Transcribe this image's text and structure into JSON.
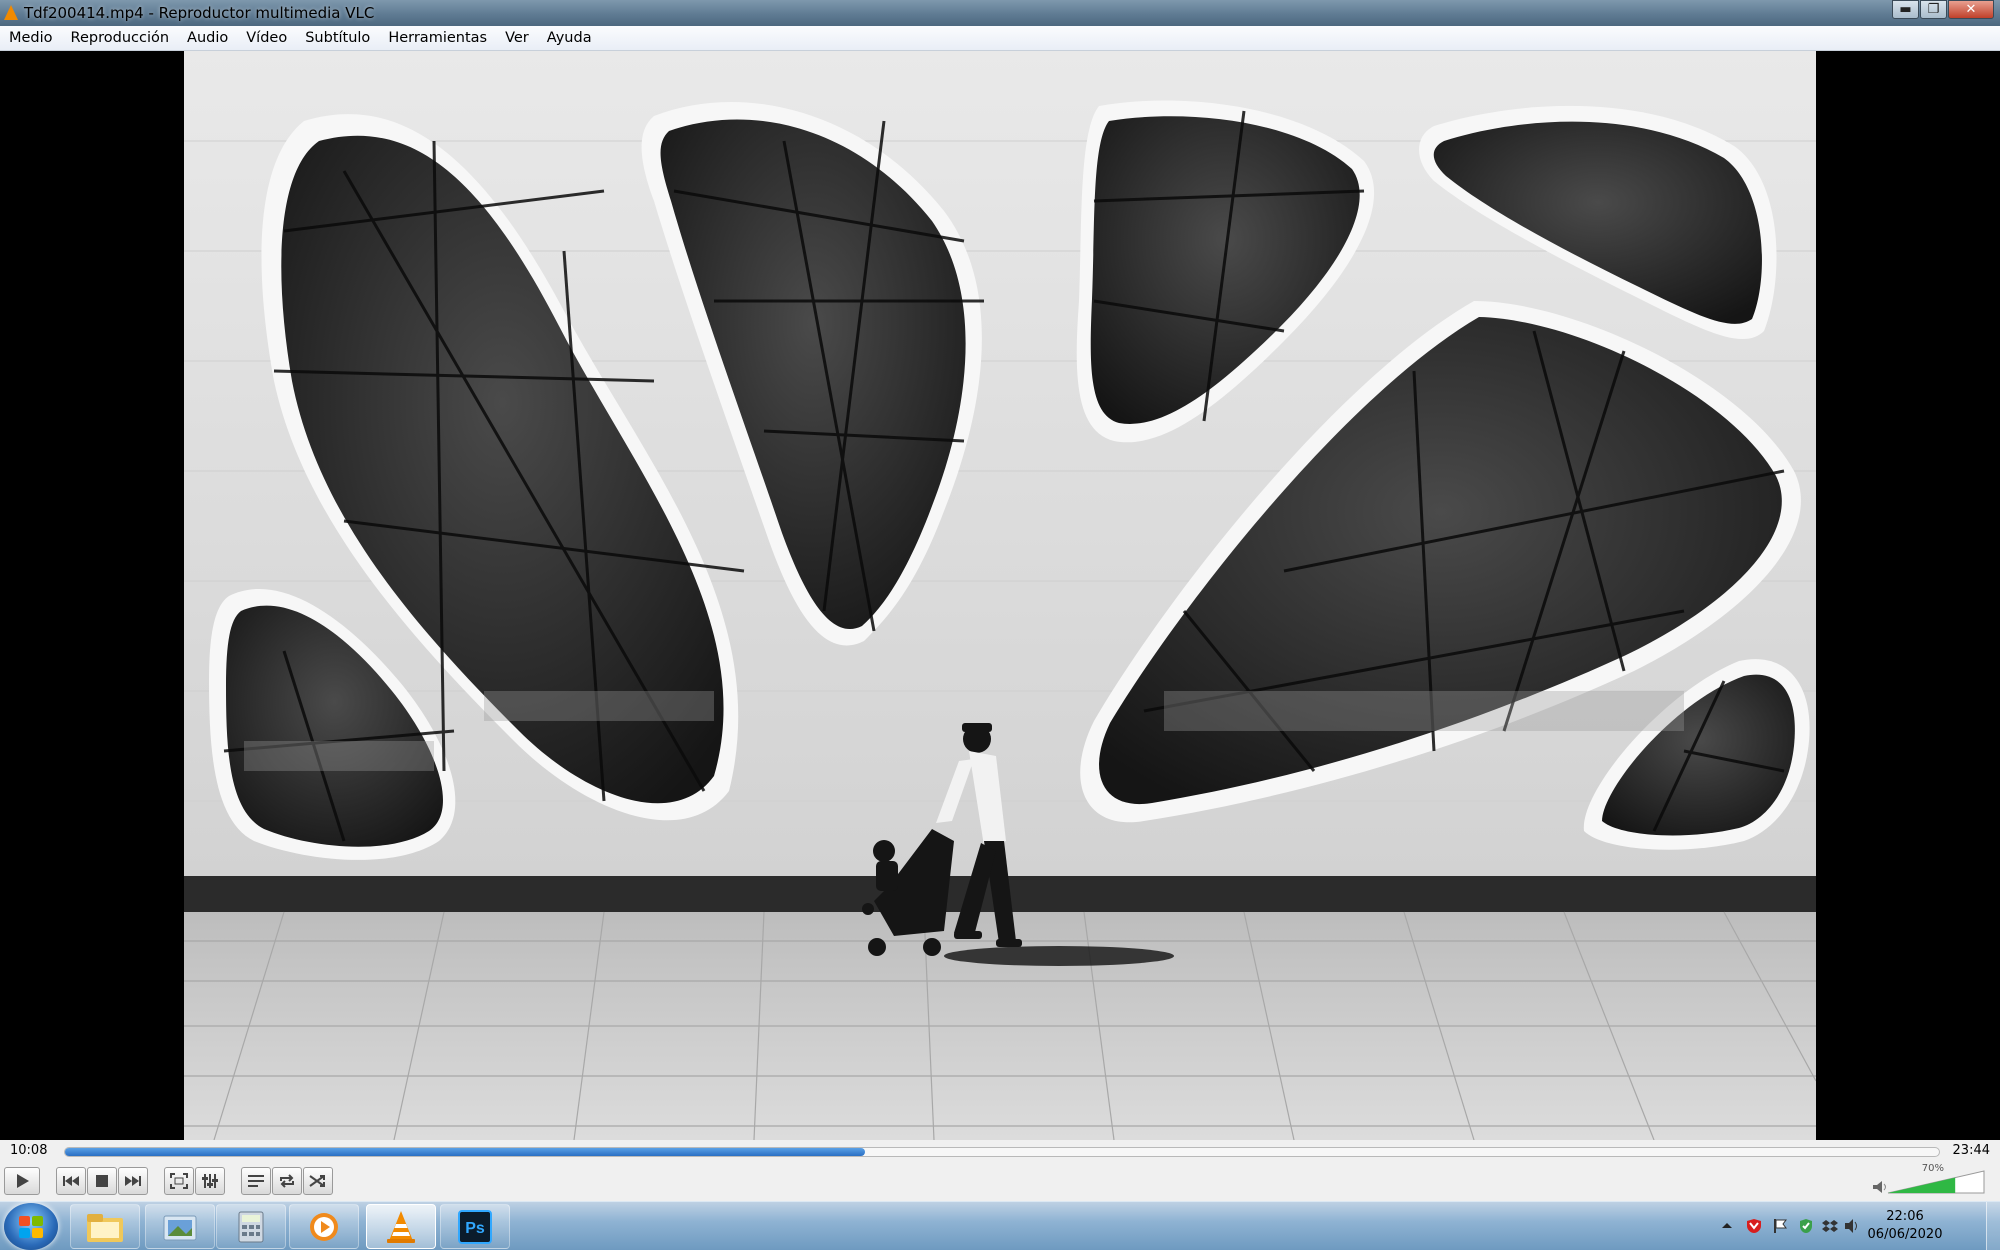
{
  "window": {
    "title": "Tdf200414.mp4 - Reproductor multimedia VLC",
    "buttons": [
      "minimize",
      "restore",
      "close"
    ]
  },
  "menu": {
    "items": [
      "Medio",
      "Reproducción",
      "Audio",
      "Vídeo",
      "Subtítulo",
      "Herramientas",
      "Ver",
      "Ayuda"
    ]
  },
  "video": {
    "content": "black-and-white-photo-building-facade"
  },
  "playback": {
    "current_time": "10:08",
    "total_time": "23:44",
    "progress": 0.427
  },
  "controls": {
    "buttons": [
      "play-icon",
      "previous-icon",
      "stop-icon",
      "next-icon",
      "fullscreen-icon",
      "extended-settings-icon",
      "playlist-icon",
      "loop-icon",
      "shuffle-icon"
    ],
    "volume_label": "70%",
    "volume": 0.7
  },
  "taskbar": {
    "apps": [
      "windows-explorer-icon",
      "photo-folder-icon",
      "calculator-icon",
      "media-player-icon",
      "vlc-icon",
      "photoshop-icon"
    ],
    "active_app": "vlc-icon",
    "photoshop_label": "Ps",
    "clock_time": "22:06",
    "clock_date": "06/06/2020"
  },
  "colors": {
    "accent": "#2a6fc3",
    "vlc_orange": "#f28a00",
    "ps_blue": "#31a8ff"
  }
}
